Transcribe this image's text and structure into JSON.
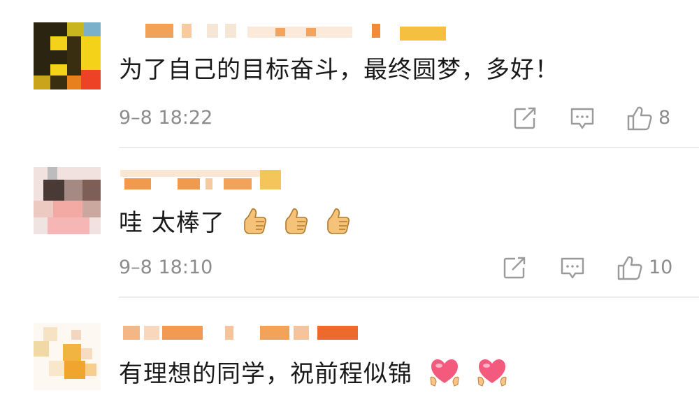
{
  "comments": [
    {
      "text": "为了自己的目标奋斗，最终圆梦，多好！",
      "time": "9–8 18:22",
      "likes": "8",
      "avatar_icon": "pixelated-yellow-avatar",
      "emoji": []
    },
    {
      "text": "哇 太棒了",
      "time": "9–8 18:10",
      "likes": "10",
      "avatar_icon": "pixelated-cow-avatar",
      "emoji": [
        "thumbs-up-emoji",
        "thumbs-up-emoji",
        "thumbs-up-emoji"
      ]
    },
    {
      "text": "有理想的同学，祝前程似锦",
      "time": "",
      "likes": "",
      "avatar_icon": "pixelated-orange-avatar",
      "emoji": [
        "heart-hands-emoji",
        "heart-hands-emoji"
      ]
    }
  ],
  "colors": {
    "text": "#1a1a1a",
    "meta": "#8c8c8c",
    "icon": "#9a9a9a",
    "divider": "#ececec",
    "nickname_blur": "#f3a35c"
  },
  "icons": [
    "share-icon",
    "reply-icon",
    "like-icon"
  ]
}
